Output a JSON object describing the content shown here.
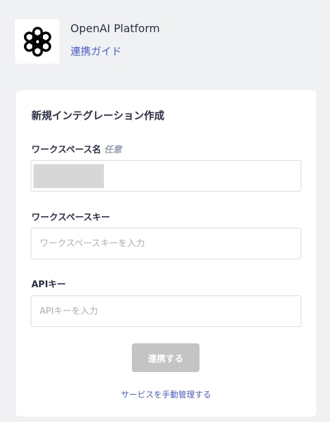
{
  "header": {
    "logo_icon": "openai-logo-icon",
    "app_title": "OpenAI Platform",
    "guide_link": "連携ガイド"
  },
  "form": {
    "title": "新規インテグレーション作成",
    "workspace_name": {
      "label": "ワークスペース名",
      "optional_tag": "任意",
      "value": ""
    },
    "workspace_key": {
      "label": "ワークスペースキー",
      "placeholder": "ワークスペースキーを入力",
      "value": ""
    },
    "api_key": {
      "label": "APIキー",
      "placeholder": "APIキーを入力",
      "value": ""
    },
    "submit_label": "連携する",
    "manual_link": "サービスを手動管理する"
  },
  "colors": {
    "link": "#4a5fd0",
    "button_disabled": "#c4c4c4",
    "background": "#f0f1f3"
  }
}
